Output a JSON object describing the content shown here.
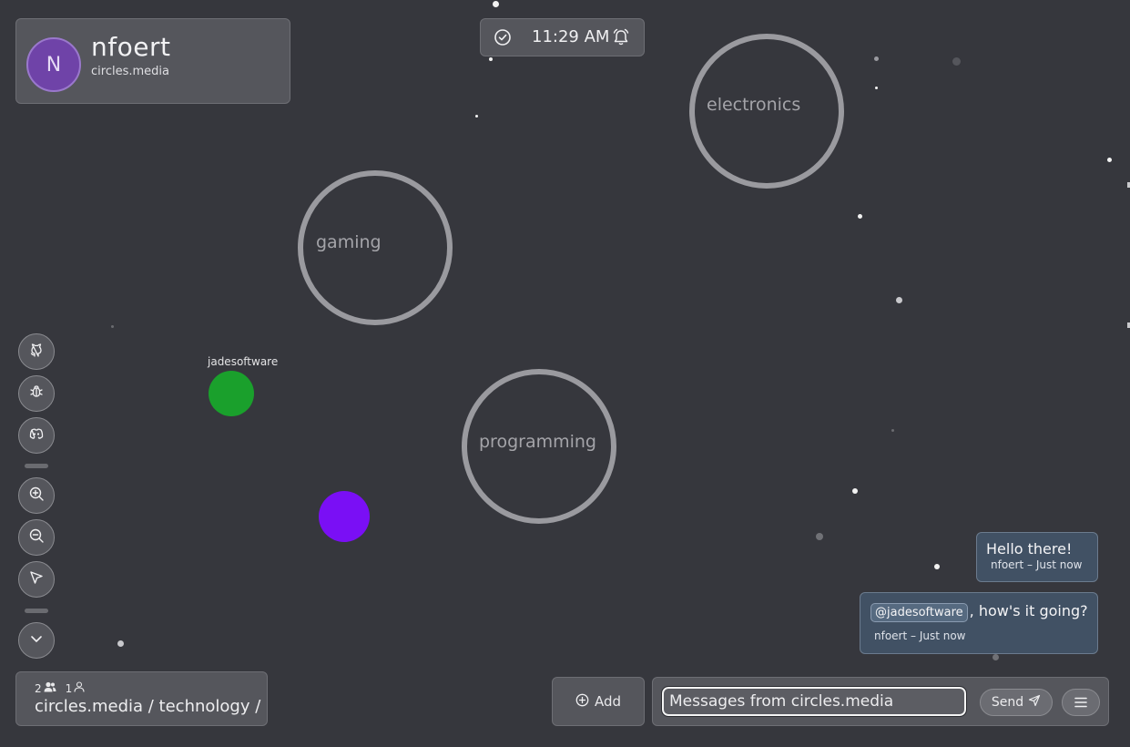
{
  "user": {
    "initial": "N",
    "name": "nfoert",
    "domain": "circles.media"
  },
  "clock": {
    "time": "11:29 AM"
  },
  "circles": [
    {
      "label": "electronics"
    },
    {
      "label": "gaming"
    },
    {
      "label": "programming"
    }
  ],
  "people": [
    {
      "name": "jadesoftware",
      "color": "#1aa02c"
    },
    {
      "name": "",
      "color": "#7a0ff5"
    }
  ],
  "tools": [
    "github-icon",
    "bug-icon",
    "discord-icon",
    "zoom-in-icon",
    "zoom-out-icon",
    "pointer-icon",
    "chevron-down-icon"
  ],
  "path": {
    "users_count": "2",
    "self_count": "1",
    "breadcrumb": "circles.media / technology /"
  },
  "add": {
    "label": "Add"
  },
  "message": {
    "placeholder": "Messages from circles.media",
    "send_label": "Send"
  },
  "chat": [
    {
      "text": "Hello there!",
      "meta": "nfoert – Just now"
    },
    {
      "mention": "@jadesoftware",
      "text": ", how's it going?",
      "meta": "nfoert – Just now"
    }
  ],
  "colors": {
    "background": "#36373d",
    "panel": "#55565c",
    "bubble": "#415164"
  }
}
